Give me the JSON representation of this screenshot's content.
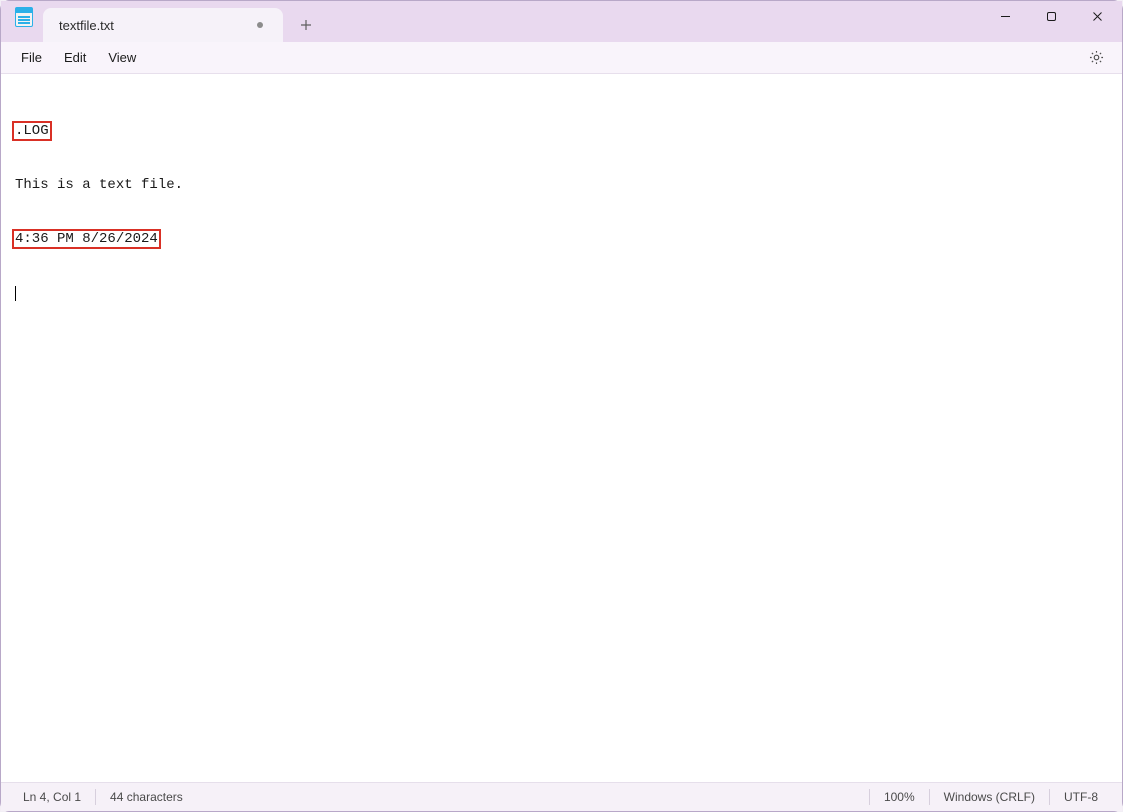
{
  "tab": {
    "title": "textfile.txt",
    "dirty": true
  },
  "menu": {
    "file": "File",
    "edit": "Edit",
    "view": "View"
  },
  "editor": {
    "lines": {
      "l1": ".LOG",
      "l2": "This is a text file.",
      "l3": "4:36 PM 8/26/2024"
    }
  },
  "status": {
    "position": "Ln 4, Col 1",
    "chars": "44 characters",
    "zoom": "100%",
    "line_ending": "Windows (CRLF)",
    "encoding": "UTF-8"
  }
}
